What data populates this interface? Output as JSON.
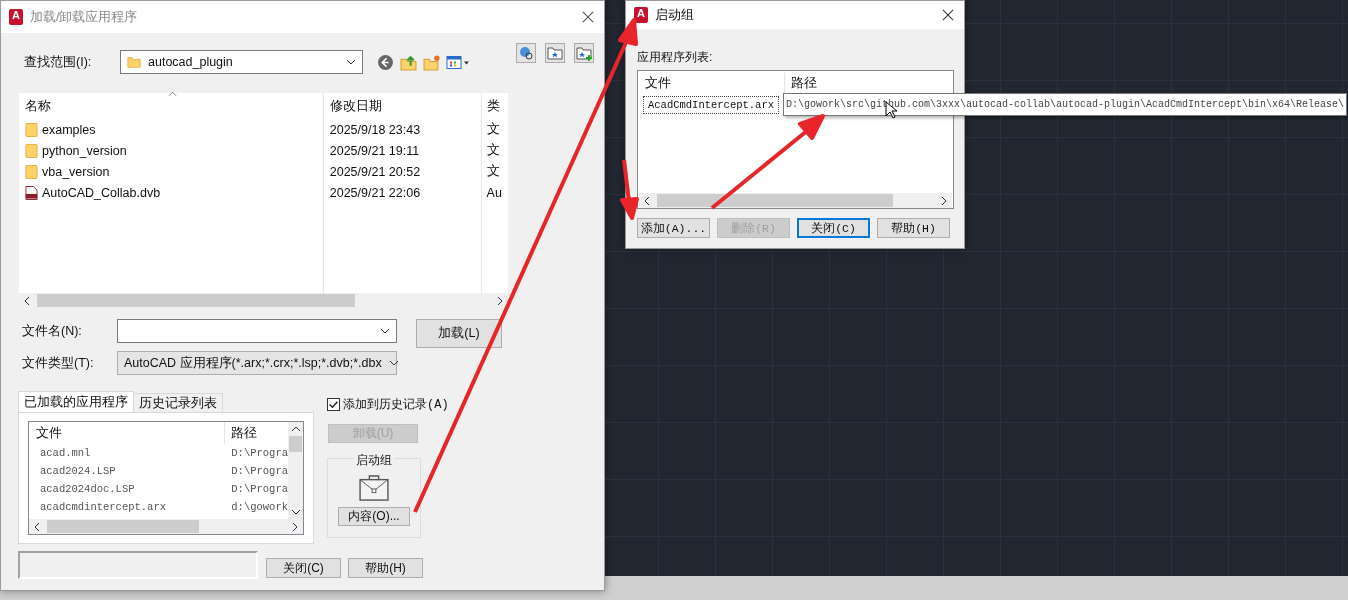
{
  "load_dialog": {
    "icon_letter": "A",
    "title": "加载/卸载应用程序",
    "look_in": {
      "label": "查找范围(I):",
      "value": "autocad_plugin"
    },
    "file_list": {
      "columns": [
        "名称",
        "修改日期",
        "类"
      ],
      "rows": [
        {
          "kind": "folder",
          "name": "examples",
          "modified": "2025/9/18 23:43",
          "column_3": "文"
        },
        {
          "kind": "folder",
          "name": "python_version",
          "modified": "2025/9/21 19:11",
          "column_3": "文"
        },
        {
          "kind": "folder",
          "name": "vba_version",
          "modified": "2025/9/21 20:52",
          "column_3": "文"
        },
        {
          "kind": "dvb",
          "name": "AutoCAD_Collab.dvb",
          "modified": "2025/9/21 22:06",
          "column_3": "Au"
        }
      ]
    },
    "file_name": {
      "label": "文件名(N):"
    },
    "file_type": {
      "label": "文件类型(T):",
      "value": "AutoCAD 应用程序(*.arx;*.crx;*.lsp;*.dvb;*.dbx"
    },
    "load_button": "加载(L)",
    "tabs": [
      {
        "label": "已加载的应用程序",
        "selected": true
      },
      {
        "label": "历史记录列表",
        "selected": false
      }
    ],
    "loaded_apps": {
      "columns": [
        "文件",
        "路径"
      ],
      "rows": [
        {
          "file": "acad.mnl",
          "path": "D:\\Progra"
        },
        {
          "file": "acad2024.LSP",
          "path": "D:\\Progra"
        },
        {
          "file": "acad2024doc.LSP",
          "path": "D:\\Progra"
        },
        {
          "file": "acadcmdintercept.arx",
          "path": "d:\\gowork"
        }
      ]
    },
    "add_to_history": {
      "label": "添加到历史记录(A)",
      "checked": true
    },
    "unload_button": {
      "label": "卸载(U)",
      "disabled": true
    },
    "startup_suite": {
      "title": "启动组",
      "contents_button": "内容(O)..."
    },
    "buttons": [
      {
        "label": "关闭(C)"
      },
      {
        "label": "帮助(H)"
      }
    ]
  },
  "startup_dialog": {
    "icon_letter": "A",
    "title": "启动组",
    "list_label": "应用程序列表:",
    "columns": [
      "文件",
      "路径"
    ],
    "rows": [
      {
        "file": "AcadCmdIntercept.arx",
        "selected": true
      }
    ],
    "tooltip": "D:\\gowork\\src\\github.com\\3xxx\\autocad-collab\\autocad-plugin\\AcadCmdIntercept\\bin\\x64\\Release\\",
    "buttons": [
      {
        "label": "添加(A)...",
        "disabled": false,
        "focused": false
      },
      {
        "label": "删除(R)",
        "disabled": true,
        "focused": false
      },
      {
        "label": "关闭(C)",
        "disabled": false,
        "focused": true
      },
      {
        "label": "帮助(H)",
        "disabled": false,
        "focused": false
      }
    ]
  }
}
